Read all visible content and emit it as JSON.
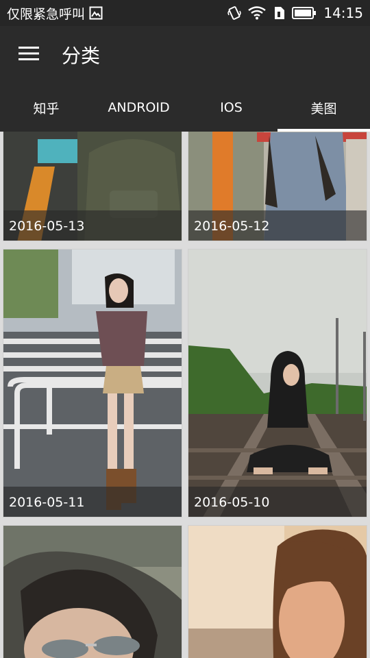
{
  "status_bar": {
    "carrier": "仅限紧急呼叫",
    "time": "14:15",
    "icons": [
      "image-icon",
      "vibrate-icon",
      "wifi-icon",
      "sim-icon",
      "battery-icon"
    ]
  },
  "toolbar": {
    "title": "分类",
    "menu_icon": "menu-icon"
  },
  "tabs": [
    {
      "label": "知乎",
      "active": false
    },
    {
      "label": "ANDROID",
      "active": false
    },
    {
      "label": "IOS",
      "active": false
    },
    {
      "label": "美图",
      "active": true
    }
  ],
  "gallery": {
    "items": [
      {
        "date": "2016-05-13"
      },
      {
        "date": "2016-05-12"
      },
      {
        "date": "2016-05-11"
      },
      {
        "date": "2016-05-10"
      },
      {
        "date": ""
      },
      {
        "date": ""
      }
    ]
  },
  "colors": {
    "toolbar": "#2b2b2b",
    "status_bar": "#262626",
    "indicator": "#ffffff"
  }
}
